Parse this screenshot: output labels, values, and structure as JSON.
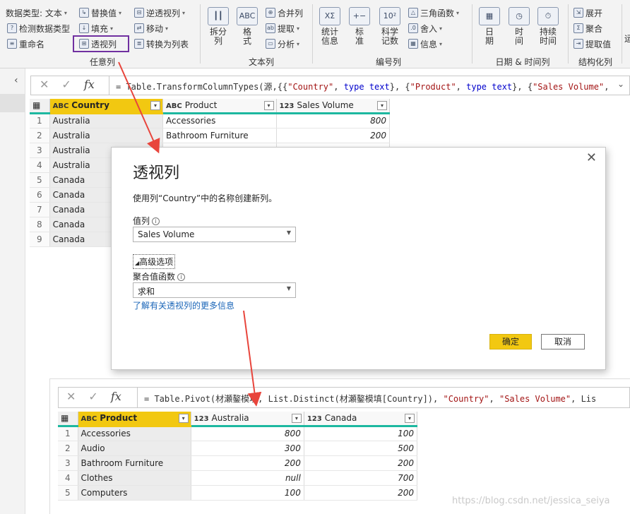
{
  "ribbon": {
    "any_column": {
      "label": "任意列",
      "datatype": "数据类型: 文本",
      "detect": "检测数据类型",
      "rename": "重命名",
      "replace": "替换值",
      "fill": "填充",
      "pivot": "透视列",
      "unpivot": "逆透视列",
      "move": "移动",
      "to_list": "转换为列表"
    },
    "text_column": {
      "label": "文本列",
      "split": "拆分\n列",
      "format": "格\n式",
      "merge": "合并列",
      "extract": "提取",
      "parse": "分析"
    },
    "number_column": {
      "label": "编号列",
      "stats": "统计\n信息",
      "standard": "标\n准",
      "scientific": "科学\n记数",
      "trig": "三角函数",
      "round": "舍入",
      "info": "信息"
    },
    "datetime": {
      "label": "日期 & 时间列",
      "date": "日\n期",
      "time": "时\n间",
      "duration": "持续\n时间"
    },
    "structured": {
      "label": "结构化列",
      "expand": "展开",
      "aggregate": "聚合",
      "extract_values": "提取值"
    },
    "overflow_text": "运"
  },
  "formula_top": {
    "prefix": "= Table.TransformColumnTypes(",
    "src": "源",
    "rest_a": ",{{",
    "s1": "\"Country\"",
    "sep1": ", ",
    "t1": "type text",
    "rest_b": "}, {",
    "s2": "\"Product\"",
    "sep2": ", ",
    "t2": "type text",
    "rest_c": "}, {",
    "s3": "\"Sales Volume\"",
    "rest_d": ","
  },
  "top_table": {
    "columns": [
      {
        "type": "ABC",
        "name": "Country"
      },
      {
        "type": "ABC",
        "name": "Product"
      },
      {
        "type": "123",
        "name": "Sales Volume"
      }
    ],
    "rows": [
      [
        "1",
        "Australia",
        "Accessories",
        "800"
      ],
      [
        "2",
        "Australia",
        "Bathroom Furniture",
        "200"
      ],
      [
        "3",
        "Australia",
        "",
        ""
      ],
      [
        "4",
        "Australia",
        "",
        ""
      ],
      [
        "5",
        "Canada",
        "",
        ""
      ],
      [
        "6",
        "Canada",
        "",
        ""
      ],
      [
        "7",
        "Canada",
        "",
        ""
      ],
      [
        "8",
        "Canada",
        "",
        ""
      ],
      [
        "9",
        "Canada",
        "",
        ""
      ]
    ]
  },
  "dialog": {
    "title": "透视列",
    "description": "使用列“Country”中的名称创建新列。",
    "values_label": "值列",
    "values_selected": "Sales Volume",
    "advanced": "高级选项",
    "agg_label": "聚合值函数",
    "agg_selected": "求和",
    "learn_more": "了解有关透视列的更多信息",
    "ok": "确定",
    "cancel": "取消",
    "close": "✕"
  },
  "formula_bottom": {
    "prefix": "= Table.Pivot(",
    "a1": "材瀬鏊模填",
    "mid1": ", List.Distinct(",
    "a2": "材瀬鏊模填",
    "mid2": "[Country]), ",
    "s1": "\"Country\"",
    "sep": ", ",
    "s2": "\"Sales Volume\"",
    "tail": ", List.Sum)"
  },
  "bottom_table": {
    "columns": [
      {
        "type": "ABC",
        "name": "Product"
      },
      {
        "type": "123",
        "name": "Australia"
      },
      {
        "type": "123",
        "name": "Canada"
      }
    ],
    "rows": [
      [
        "1",
        "Accessories",
        "800",
        "100"
      ],
      [
        "2",
        "Audio",
        "300",
        "500"
      ],
      [
        "3",
        "Bathroom Furniture",
        "200",
        "200"
      ],
      [
        "4",
        "Clothes",
        "null",
        "700"
      ],
      [
        "5",
        "Computers",
        "100",
        "200"
      ]
    ]
  },
  "watermark": "https://blog.csdn.net/jessica_seiya",
  "colors": {
    "accent_yellow": "#f2c811",
    "teal": "#1db8a0",
    "arrow_red": "#e8453c",
    "highlight_purple": "#7030a0"
  }
}
